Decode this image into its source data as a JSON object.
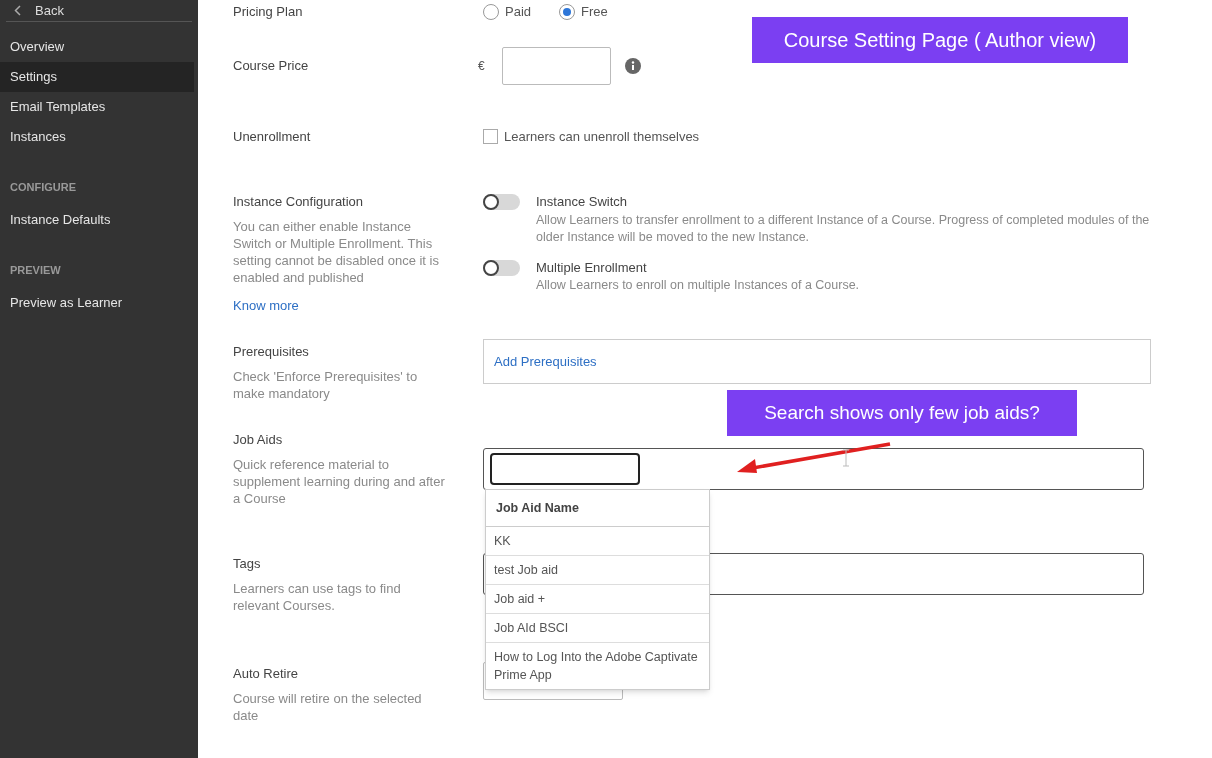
{
  "sidebar": {
    "back": "Back",
    "groups": [
      {
        "items": [
          {
            "label": "Overview",
            "selected": false
          },
          {
            "label": "Settings",
            "selected": true
          },
          {
            "label": "Email Templates",
            "selected": false
          },
          {
            "label": "Instances",
            "selected": false
          }
        ]
      },
      {
        "heading": "CONFIGURE",
        "items": [
          {
            "label": "Instance Defaults",
            "selected": false
          }
        ]
      },
      {
        "heading": "PREVIEW",
        "items": [
          {
            "label": "Preview as Learner",
            "selected": false
          }
        ]
      }
    ]
  },
  "pricing_plan": {
    "label": "Pricing Plan",
    "options": [
      {
        "label": "Paid",
        "selected": false
      },
      {
        "label": "Free",
        "selected": true
      }
    ]
  },
  "course_price": {
    "label": "Course Price",
    "currency": "€"
  },
  "unenrollment": {
    "label": "Unenrollment",
    "checkbox": {
      "label": "Learners can unenroll themselves",
      "checked": false
    }
  },
  "instance_configuration": {
    "label": "Instance Configuration",
    "description": "You can either enable Instance Switch or Multiple Enrollment. This setting cannot be disabled once it is enabled and published",
    "link": "Know more",
    "toggles": [
      {
        "title": "Instance Switch",
        "description": "Allow Learners to transfer enrollment to a different Instance of a Course. Progress of completed modules of the older Instance will be moved to the new Instance.",
        "on": false
      },
      {
        "title": "Multiple Enrollment",
        "description": "Allow Learners to enroll on multiple Instances of a Course.",
        "on": false
      }
    ]
  },
  "prerequisites": {
    "label": "Prerequisites",
    "description": "Check 'Enforce Prerequisites' to make mandatory",
    "link": "Add Prerequisites"
  },
  "job_aids": {
    "label": "Job Aids",
    "description": "Quick reference material to supplement learning during and after a Course",
    "dropdown": {
      "header": "Job Aid Name",
      "items": [
        "KK",
        "test Job aid",
        "Job aid +",
        "Job AId BSCI",
        "How to Log Into the Adobe Captivate Prime App"
      ]
    }
  },
  "tags": {
    "label": "Tags",
    "description": "Learners can use tags to find relevant Courses."
  },
  "auto_retire": {
    "label": "Auto Retire",
    "description": "Course will retire on the selected date"
  },
  "annotations": [
    "Course Setting Page ( Author view)",
    "Search shows only few job aids?"
  ]
}
